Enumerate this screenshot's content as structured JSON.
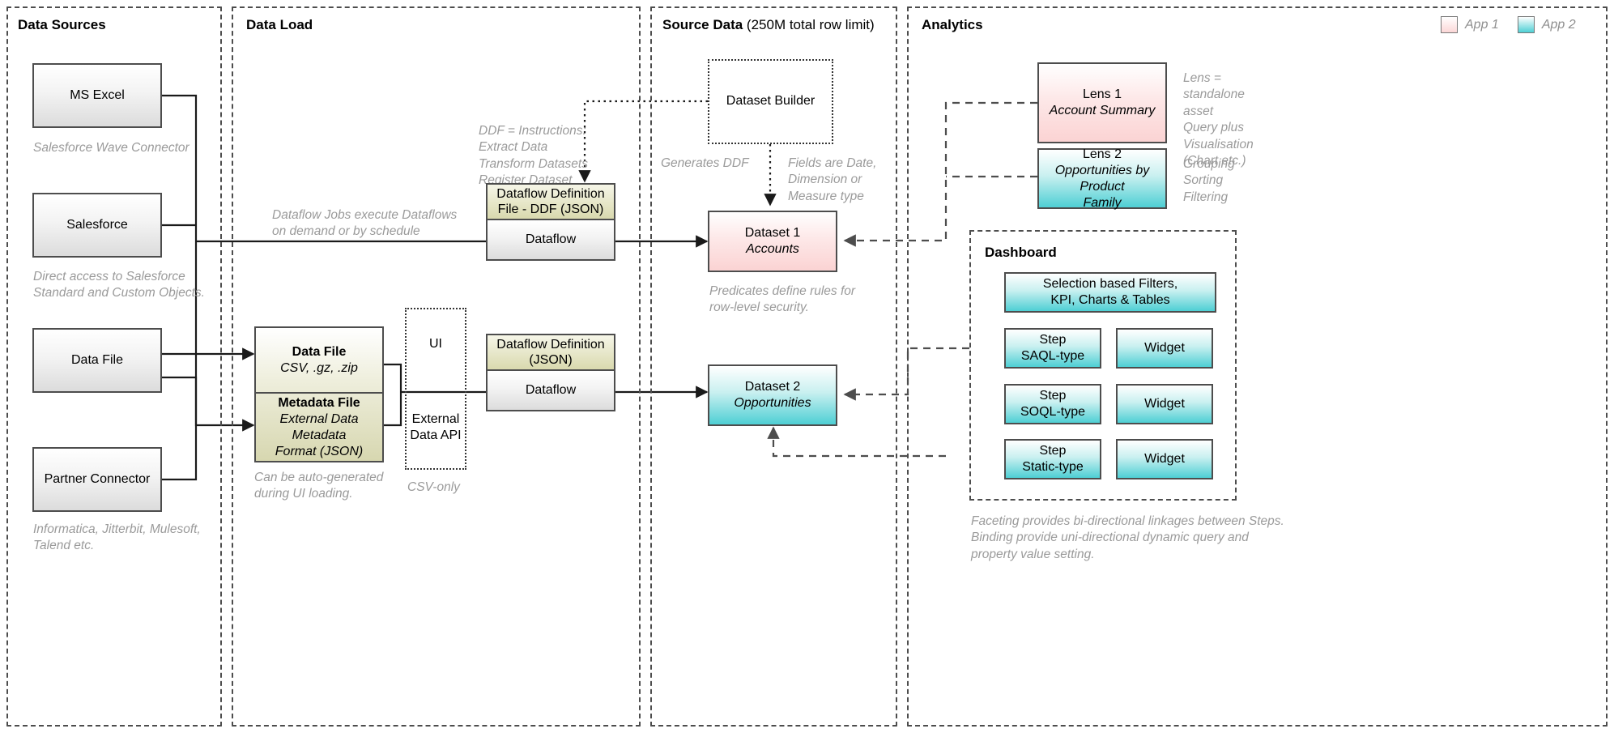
{
  "lanes": [
    {
      "id": "data-sources",
      "title": "Data Sources",
      "sub": ""
    },
    {
      "id": "data-load",
      "title": "Data Load",
      "sub": ""
    },
    {
      "id": "source-data",
      "title": "Source Data",
      "sub": " (250M total row limit)"
    },
    {
      "id": "analytics",
      "title": "Analytics",
      "sub": ""
    }
  ],
  "legend": [
    {
      "label": "App 1",
      "color": "#fbd6d6",
      "swatch": "pink"
    },
    {
      "label": "App 2",
      "color": "#4ecfd4",
      "swatch": "cyan"
    }
  ],
  "sources": {
    "ms_excel": "MS Excel",
    "ms_excel_note": "Salesforce Wave Connector",
    "salesforce": "Salesforce",
    "salesforce_note": "Direct access to Salesforce\nStandard and Custom Objects.",
    "data_file": "Data File",
    "partner_connector": "Partner Connector",
    "partner_note": "Informatica, Jitterbit, Mulesoft,\nTalend etc."
  },
  "load": {
    "dataflow_jobs_note": "Dataflow Jobs execute Dataflows\non demand or by schedule",
    "ddf_note": "DDF = Instructions:\nExtract Data\nTransform Datasets\nRegister Dataset",
    "ddf_box_header": "Dataflow Definition File -\nDDF (JSON)",
    "ddf_box_body": "Dataflow",
    "data_file_title": "Data File",
    "data_file_sub": "CSV, .gz, .zip",
    "metadata_file_title": "Metadata File",
    "metadata_file_sub": "External Data Metadata\nFormat (JSON)",
    "autogen_note": "Can be auto-generated\nduring UI loading.",
    "ui_label": "UI",
    "external_api_label": "External\nData API",
    "csv_only_note": "CSV-only",
    "dd_box_header": "Dataflow Definition\n(JSON)",
    "dd_box_body": "Dataflow"
  },
  "source_data": {
    "dataset_builder": "Dataset Builder",
    "generates_ddf_note": "Generates DDF",
    "fields_note": "Fields are Date,\nDimension or\nMeasure type",
    "dataset1_title": "Dataset 1",
    "dataset1_sub": "Accounts",
    "predicates_note": "Predicates define rules for\nrow-level security.",
    "dataset2_title": "Dataset 2",
    "dataset2_sub": "Opportunities"
  },
  "analytics": {
    "lens1_title": "Lens 1",
    "lens1_sub": "Account Summary",
    "lens1_note": "Lens =\nstandalone\nasset\nQuery plus\nVisualisation\n(Chart etc.)",
    "lens2_title": "Lens 2",
    "lens2_sub": "Opportunities by Product\nFamily",
    "lens2_note": "Grouping\nSorting\nFiltering",
    "dashboard_title": "Dashboard",
    "dashboard_header_box": "Selection based Filters,\nKPI, Charts & Tables",
    "steps": [
      {
        "title": "Step",
        "sub": "SAQL-type"
      },
      {
        "title": "Step",
        "sub": "SOQL-type"
      },
      {
        "title": "Step",
        "sub": "Static-type"
      }
    ],
    "widgets": [
      "Widget",
      "Widget",
      "Widget"
    ],
    "faceting_note": "Faceting provides bi-directional linkages between Steps.\nBinding provide uni-directional dynamic query and\nproperty value setting."
  }
}
